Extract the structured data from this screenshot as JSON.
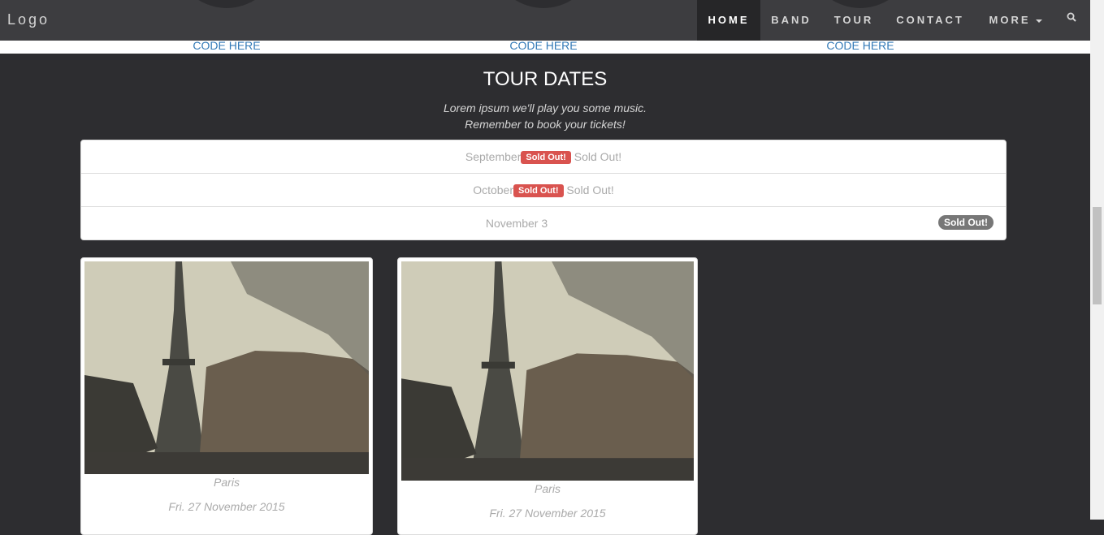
{
  "band": {
    "code_links": [
      "CODE HERE",
      "CODE HERE",
      "CODE HERE"
    ]
  },
  "navbar": {
    "logo": "Logo",
    "items": [
      {
        "label": "HOME",
        "active": true
      },
      {
        "label": "BAND"
      },
      {
        "label": "TOUR"
      },
      {
        "label": "CONTACT"
      },
      {
        "label": "MORE"
      }
    ],
    "search_icon": "search-icon"
  },
  "tour": {
    "title": "TOUR DATES",
    "subtitle_line1": "Lorem ipsum we'll play you some music.",
    "subtitle_line2": "Remember to book your tickets!",
    "dates": [
      {
        "month": "September",
        "label": "Sold Out!",
        "suffix": "Sold Out!"
      },
      {
        "month": "October",
        "label": "Sold Out!",
        "suffix": "Sold Out!"
      },
      {
        "month": "November 3",
        "badge": "Sold Out!"
      }
    ],
    "cards": [
      {
        "city": "Paris",
        "date": "Fri. 27 November 2015",
        "image": "paris-eiffel-tower-photo"
      },
      {
        "city": "Paris",
        "date": "Fri. 27 November 2015",
        "image": "paris-eiffel-tower-photo"
      }
    ]
  },
  "colors": {
    "background": "#2d2d30",
    "navbar": "#2d2d30",
    "label_danger": "#d9534f",
    "badge": "#777777",
    "link": "#337ab7"
  }
}
